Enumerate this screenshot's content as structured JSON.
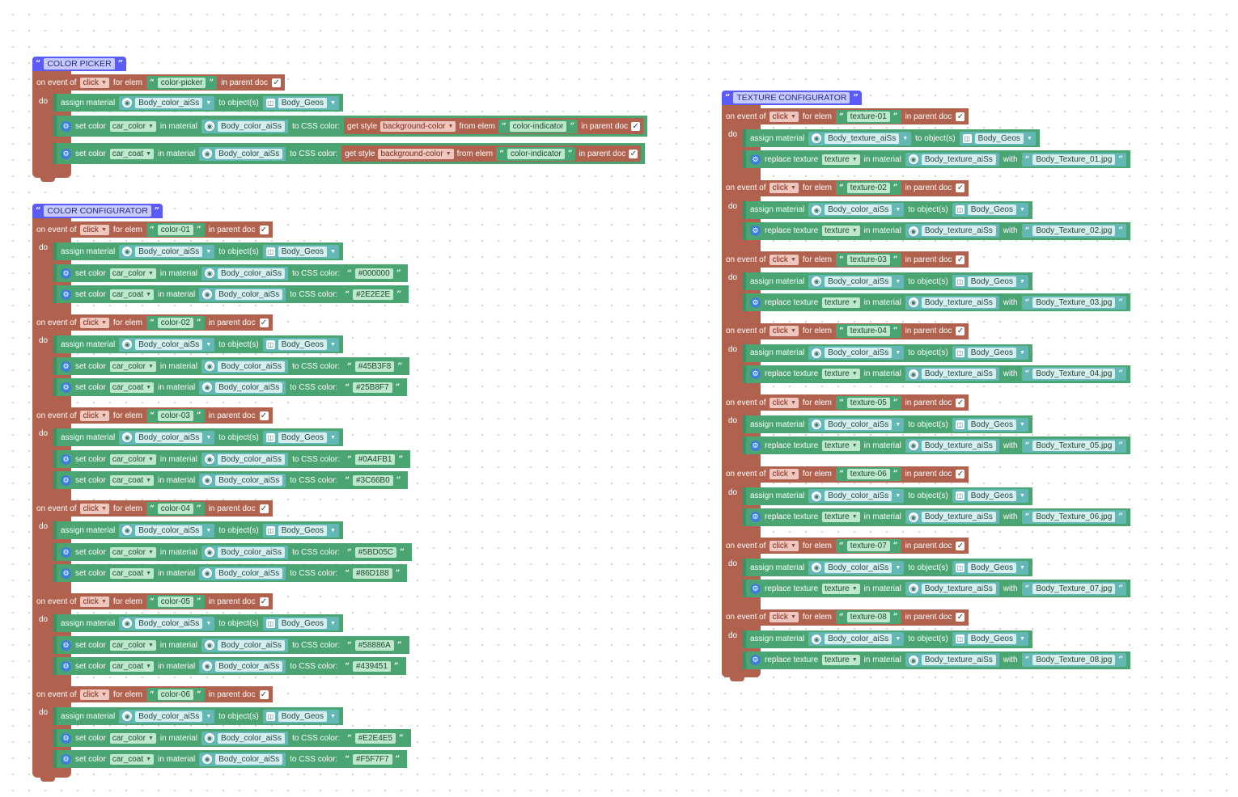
{
  "labels": {
    "on_event_of": "on event of",
    "for_elem": "for elem",
    "in_parent_doc": "in parent doc",
    "do": "do",
    "assign_material": "assign material",
    "to_objects": "to object(s)",
    "set_color": "set color",
    "in_material": "in material",
    "to_css_color": "to CSS color:",
    "get_style": "get style",
    "from_elem": "from elem",
    "replace_texture": "replace texture",
    "with": "with",
    "click": "click",
    "car_color": "car_color",
    "car_coat": "car_coat",
    "texture": "texture",
    "background_color": "background-color",
    "color_indicator": "color-indicator",
    "body_color_aiss": "Body_color_aiSs",
    "body_texture_aiss": "Body_texture_aiSs",
    "body_geos": "Body_Geos"
  },
  "color_picker": {
    "title": "COLOR PICKER",
    "elem": "color-picker"
  },
  "color_configurator": {
    "title": "COLOR CONFIGURATOR",
    "items": [
      {
        "elem": "color-01",
        "car_color": "#000000",
        "car_coat": "#2E2E2E"
      },
      {
        "elem": "color-02",
        "car_color": "#45B3F8",
        "car_coat": "#25B8F7"
      },
      {
        "elem": "color-03",
        "car_color": "#0A4FB1",
        "car_coat": "#3C66B0"
      },
      {
        "elem": "color-04",
        "car_color": "#5BD05C",
        "car_coat": "#86D188"
      },
      {
        "elem": "color-05",
        "car_color": "#58886A",
        "car_coat": "#439451"
      },
      {
        "elem": "color-06",
        "car_color": "#E2E4E5",
        "car_coat": "#F5F7F7"
      }
    ]
  },
  "texture_configurator": {
    "title": "TEXTURE CONFIGURATOR",
    "items": [
      {
        "elem": "texture-01",
        "assign_material": "Body_texture_aiSs",
        "file": "Body_Texture_01.jpg"
      },
      {
        "elem": "texture-02",
        "assign_material": "Body_color_aiSs",
        "file": "Body_Texture_02.jpg"
      },
      {
        "elem": "texture-03",
        "assign_material": "Body_color_aiSs",
        "file": "Body_Texture_03.jpg"
      },
      {
        "elem": "texture-04",
        "assign_material": "Body_color_aiSs",
        "file": "Body_Texture_04.jpg"
      },
      {
        "elem": "texture-05",
        "assign_material": "Body_color_aiSs",
        "file": "Body_Texture_05.jpg"
      },
      {
        "elem": "texture-06",
        "assign_material": "Body_color_aiSs",
        "file": "Body_Texture_06.jpg"
      },
      {
        "elem": "texture-07",
        "assign_material": "Body_color_aiSs",
        "file": "Body_Texture_07.jpg"
      },
      {
        "elem": "texture-08",
        "assign_material": "Body_color_aiSs",
        "file": "Body_Texture_08.jpg"
      }
    ]
  }
}
